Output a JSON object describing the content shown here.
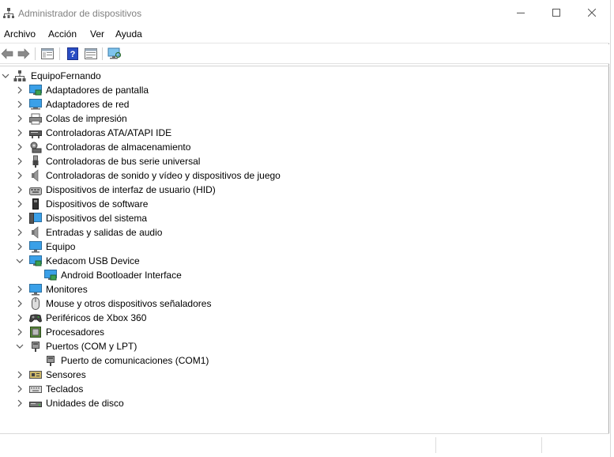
{
  "window": {
    "title": "Administrador de dispositivos"
  },
  "menu": {
    "items": [
      "Archivo",
      "Acción",
      "Ver",
      "Ayuda"
    ]
  },
  "toolbar": {
    "buttons": [
      "back-arrow-icon",
      "forward-arrow-icon",
      "properties-pane-icon",
      "help-icon",
      "view-pane-icon",
      "scan-hardware-icon"
    ]
  },
  "tree": {
    "root": "EquipoFernando",
    "categories": [
      {
        "label": "Adaptadores de pantalla",
        "icon": "display-adapter-icon",
        "expanded": false
      },
      {
        "label": "Adaptadores de red",
        "icon": "network-adapter-icon",
        "expanded": false
      },
      {
        "label": "Colas de impresión",
        "icon": "printer-icon",
        "expanded": false
      },
      {
        "label": "Controladoras ATA/ATAPI IDE",
        "icon": "ide-controller-icon",
        "expanded": false
      },
      {
        "label": "Controladoras de almacenamiento",
        "icon": "storage-controller-icon",
        "expanded": false
      },
      {
        "label": "Controladoras de bus serie universal",
        "icon": "usb-icon",
        "expanded": false
      },
      {
        "label": "Controladoras de sonido y vídeo y dispositivos de juego",
        "icon": "speaker-icon",
        "expanded": false
      },
      {
        "label": "Dispositivos de interfaz de usuario (HID)",
        "icon": "hid-icon",
        "expanded": false
      },
      {
        "label": "Dispositivos de software",
        "icon": "software-device-icon",
        "expanded": false
      },
      {
        "label": "Dispositivos del sistema",
        "icon": "system-device-icon",
        "expanded": false
      },
      {
        "label": "Entradas y salidas de audio",
        "icon": "speaker-icon",
        "expanded": false
      },
      {
        "label": "Equipo",
        "icon": "computer-icon",
        "expanded": false
      },
      {
        "label": "Kedacom USB Device",
        "icon": "monitor-device-icon",
        "expanded": true,
        "children": [
          {
            "label": "Android Bootloader Interface",
            "icon": "monitor-device-icon"
          }
        ]
      },
      {
        "label": "Monitores",
        "icon": "monitor-icon",
        "expanded": false
      },
      {
        "label": "Mouse y otros dispositivos señaladores",
        "icon": "mouse-icon",
        "expanded": false
      },
      {
        "label": "Periféricos de Xbox 360",
        "icon": "gamepad-icon",
        "expanded": false
      },
      {
        "label": "Procesadores",
        "icon": "cpu-icon",
        "expanded": false
      },
      {
        "label": "Puertos (COM y LPT)",
        "icon": "port-icon",
        "expanded": true,
        "children": [
          {
            "label": "Puerto de comunicaciones (COM1)",
            "icon": "port-icon"
          }
        ]
      },
      {
        "label": "Sensores",
        "icon": "sensor-icon",
        "expanded": false
      },
      {
        "label": "Teclados",
        "icon": "keyboard-icon",
        "expanded": false
      },
      {
        "label": "Unidades de disco",
        "icon": "disk-drive-icon",
        "expanded": false
      }
    ]
  },
  "colors": {
    "chevron": "#555555",
    "title_text": "#808080",
    "monitor_blue": "#3aa0e8"
  }
}
